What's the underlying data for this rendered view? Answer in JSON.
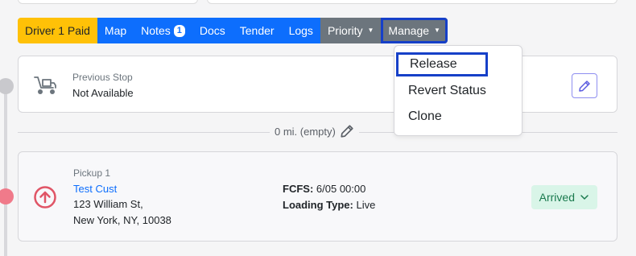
{
  "action_bar": {
    "paid_label": "Driver 1 Paid",
    "map_label": "Map",
    "notes_label": "Notes",
    "notes_count": "1",
    "docs_label": "Docs",
    "tender_label": "Tender",
    "logs_label": "Logs",
    "priority_label": "Priority",
    "manage_label": "Manage"
  },
  "manage_menu": {
    "items": [
      "Release",
      "Revert Status",
      "Clone"
    ]
  },
  "previous_stop": {
    "label": "Previous Stop",
    "value": "Not Available"
  },
  "distance": {
    "text": "0 mi. (empty)"
  },
  "pickup": {
    "label": "Pickup 1",
    "customer": "Test Cust",
    "address_line1": "123 William St,",
    "address_line2": "New York, NY, 10038",
    "fcfs_label": "FCFS:",
    "fcfs_value": "6/05 00:00",
    "loading_label": "Loading Type:",
    "loading_value": "Live",
    "status": "Arrived"
  },
  "colors": {
    "primary": "#0d6efd",
    "warning": "#ffc107",
    "secondary": "#6c757d",
    "highlight": "#1640c8",
    "success_bg": "#d9f5e8",
    "success_text": "#1a7a4e",
    "danger": "#e05566"
  }
}
